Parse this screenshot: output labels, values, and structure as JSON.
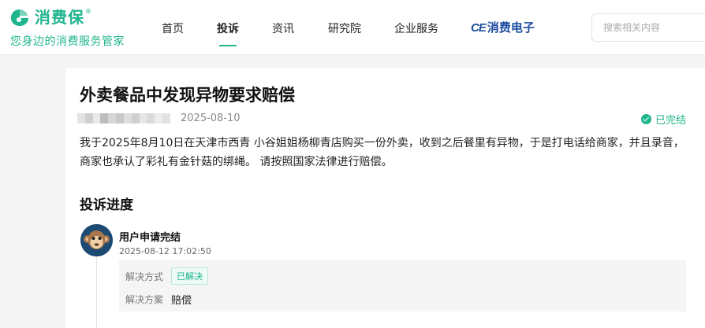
{
  "header": {
    "logo_text": "消费保",
    "logo_reg": "®",
    "slogan": "您身边的消费服务管家",
    "nav": [
      {
        "label": "首页",
        "active": false
      },
      {
        "label": "投诉",
        "active": true
      },
      {
        "label": "资讯",
        "active": false
      },
      {
        "label": "研究院",
        "active": false
      },
      {
        "label": "企业服务",
        "active": false
      }
    ],
    "partner": {
      "prefix": "CE",
      "name": "消费电子"
    },
    "search_placeholder": "搜索相关内容",
    "accent_color": "#1fb58d"
  },
  "complaint": {
    "title": "外卖餐品中发现异物要求赔偿",
    "user_name_pixelated": true,
    "date": "2025-08-10",
    "status": "已完结",
    "description": "我于2025年8月10日在天津市西青 小谷姐姐杨柳青店购买一份外卖，收到之后餐里有异物，于是打电话给商家，并且录音，商家也承认了彩礼有金针菇的绑绳。 请按照国家法律进行赔偿。"
  },
  "progress": {
    "title": "投诉进度",
    "events": [
      {
        "title": "用户申请完结",
        "time": "2025-08-12 17:02:50",
        "avatar_icon": "monkey-avatar-icon",
        "resolution_method_label": "解决方式",
        "resolution_method_value": "已解决",
        "resolution_plan_label": "解决方案",
        "resolution_plan_value": "赔偿"
      }
    ]
  }
}
